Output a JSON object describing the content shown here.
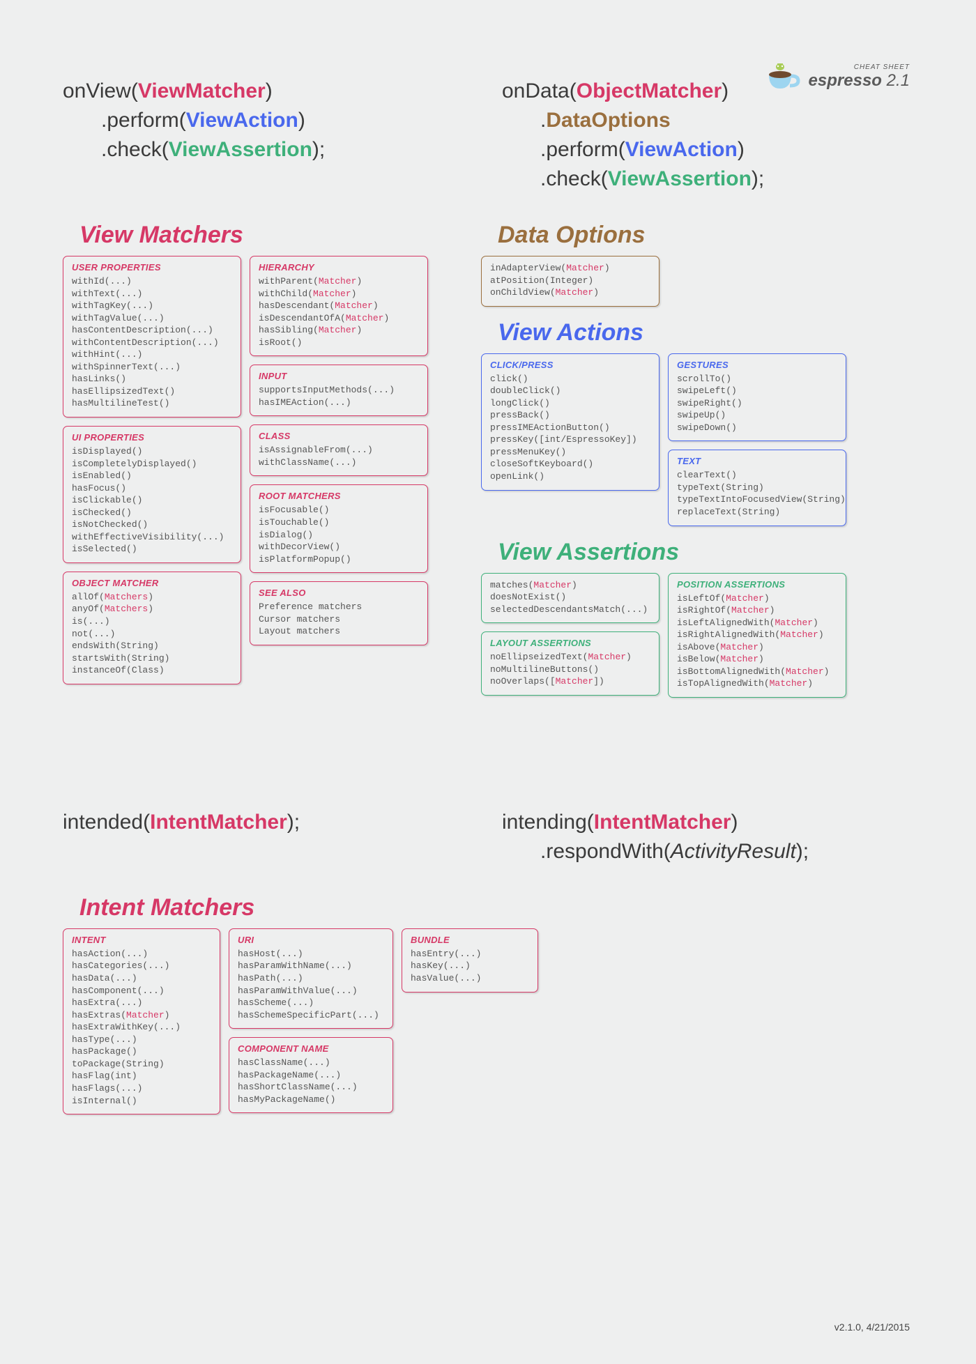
{
  "logo": {
    "cheat_sheet": "CHEAT SHEET",
    "name": "espresso",
    "version": "2.1"
  },
  "sig1": {
    "l1a": "onView",
    "l1b": "ViewMatcher",
    "l2a": ".perform(",
    "l2b": "ViewAction",
    "l2c": ")",
    "l3a": ".check(",
    "l3b": "ViewAssertion",
    "l3c": ");"
  },
  "sig2": {
    "l1a": "onData",
    "l1b": "ObjectMatcher",
    "l2a": ".",
    "l2b": "DataOptions",
    "l3a": ".perform(",
    "l3b": "ViewAction",
    "l3c": ")",
    "l4a": ".check(",
    "l4b": "ViewAssertion",
    "l4c": ");"
  },
  "vm_title": "View Matchers",
  "vm_user_props": {
    "title": "USER PROPERTIES",
    "body": "withId(...)\nwithText(...)\nwithTagKey(...)\nwithTagValue(...)\nhasContentDescription(...)\nwithContentDescription(...)\nwithHint(...)\nwithSpinnerText(...)\nhasLinks()\nhasEllipsizedText()\nhasMultilineTest()"
  },
  "vm_ui_props": {
    "title": "UI PROPERTIES",
    "body": "isDisplayed()\nisCompletelyDisplayed()\nisEnabled()\nhasFocus()\nisClickable()\nisChecked()\nisNotChecked()\nwithEffectiveVisibility(...)\nisSelected()"
  },
  "vm_obj": {
    "title": "OBJECT MATCHER",
    "pre1": "allOf(",
    "arg1": "Matchers",
    "post1": ")\n",
    "pre2": "anyOf(",
    "arg2": "Matchers",
    "post2": ")\n",
    "rest": "is(...)\nnot(...)\nendsWith(String)\nstartsWith(String)\ninstanceOf(Class)"
  },
  "vm_hier": {
    "title": "HIERARCHY",
    "pairs": [
      [
        "withParent(",
        "Matcher",
        ")"
      ],
      [
        "withChild(",
        "Matcher",
        ")"
      ],
      [
        "hasDescendant(",
        "Matcher",
        ")"
      ],
      [
        "isDescendantOfA(",
        "Matcher",
        ")"
      ],
      [
        "hasSibling(",
        "Matcher",
        ")"
      ]
    ],
    "tail": "isRoot()"
  },
  "vm_input": {
    "title": "INPUT",
    "body": "supportsInputMethods(...)\nhasIMEAction(...)"
  },
  "vm_class": {
    "title": "CLASS",
    "body": "isAssignableFrom(...)\nwithClassName(...)"
  },
  "vm_root": {
    "title": "ROOT MATCHERS",
    "body": "isFocusable()\nisTouchable()\nisDialog()\nwithDecorView()\nisPlatformPopup()"
  },
  "vm_see": {
    "title": "SEE ALSO",
    "body": "Preference matchers\nCursor matchers\nLayout matchers"
  },
  "do_title": "Data Options",
  "do_card": {
    "pairs": [
      [
        "inAdapterView(",
        "Matcher",
        ")"
      ],
      [
        "atPosition(Integer)",
        "",
        ""
      ],
      [
        "onChildView(",
        "Matcher",
        ")"
      ]
    ]
  },
  "va_title": "View Actions",
  "va_click": {
    "title": "CLICK/PRESS",
    "body": "click()\ndoubleClick()\nlongClick()\npressBack()\npressIMEActionButton()\npressKey([int/EspressoKey])\npressMenuKey()\ncloseSoftKeyboard()\nopenLink()"
  },
  "va_gest": {
    "title": "GESTURES",
    "body": "scrollTo()\nswipeLeft()\nswipeRight()\nswipeUp()\nswipeDown()"
  },
  "va_text": {
    "title": "TEXT",
    "body": "clearText()\ntypeText(String)\ntypeTextIntoFocusedView(String)\nreplaceText(String)"
  },
  "vass_title": "View Assertions",
  "vass_main": {
    "pairs": [
      [
        "matches(",
        "Matcher",
        ")"
      ],
      [
        "doesNotExist()",
        "",
        ""
      ],
      [
        "selectedDescendantsMatch(...)",
        "",
        ""
      ]
    ]
  },
  "vass_layout": {
    "title": "LAYOUT ASSERTIONS",
    "pairs": [
      [
        "noEllipseizedText(",
        "Matcher",
        ")"
      ],
      [
        "noMultilineButtons()",
        "",
        ""
      ],
      [
        "noOverlaps([",
        "Matcher",
        "])"
      ]
    ]
  },
  "vass_pos": {
    "title": "POSITION ASSERTIONS",
    "pairs": [
      [
        "isLeftOf(",
        "Matcher",
        ")"
      ],
      [
        "isRightOf(",
        "Matcher",
        ")"
      ],
      [
        "isLeftAlignedWith(",
        "Matcher",
        ")"
      ],
      [
        "isRightAlignedWith(",
        "Matcher",
        ")"
      ],
      [
        "isAbove(",
        "Matcher",
        ")"
      ],
      [
        "isBelow(",
        "Matcher",
        ")"
      ],
      [
        "isBottomAlignedWith(",
        "Matcher",
        ")"
      ],
      [
        "isTopAlignedWith(",
        "Matcher",
        ")"
      ]
    ]
  },
  "sig3": {
    "l1a": "intended",
    "l1b": "IntentMatcher",
    "l1c": ");"
  },
  "sig4": {
    "l1a": "intending",
    "l1b": "IntentMatcher",
    "l1c": ")",
    "l2a": ".respondWith(",
    "l2b": "ActivityResult",
    "l2c": ");"
  },
  "im_title": "Intent Matchers",
  "im_intent": {
    "title": "INTENT",
    "pre": "hasAction(...)\nhasCategories(...)\nhasData(...)\nhasComponent(...)\nhasExtra(...)\n",
    "mid_pre": "hasExtras(",
    "mid_arg": "Matcher",
    "mid_post": ")\n",
    "post": "hasExtraWithKey(...)\nhasType(...)\nhasPackage()\ntoPackage(String)\nhasFlag(int)\nhasFlags(...)\nisInternal()"
  },
  "im_uri": {
    "title": "URI",
    "body": "hasHost(...)\nhasParamWithName(...)\nhasPath(...)\nhasParamWithValue(...)\nhasScheme(...)\nhasSchemeSpecificPart(...)"
  },
  "im_comp": {
    "title": "COMPONENT NAME",
    "body": "hasClassName(...)\nhasPackageName(...)\nhasShortClassName(...)\nhasMyPackageName()"
  },
  "im_bundle": {
    "title": "BUNDLE",
    "body": "hasEntry(...)\nhasKey(...)\nhasValue(...)"
  },
  "footer": "v2.1.0, 4/21/2015"
}
